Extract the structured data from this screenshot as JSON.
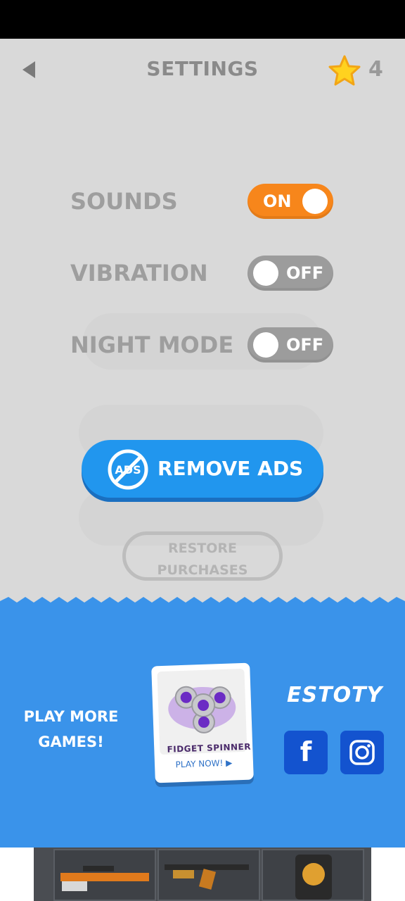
{
  "header": {
    "title": "SETTINGS",
    "back_icon": "back-arrow-icon",
    "star_icon": "star-icon",
    "star_count": "4"
  },
  "settings": {
    "sounds": {
      "label": "SOUNDS",
      "state": "ON"
    },
    "vibration": {
      "label": "VIBRATION",
      "state": "OFF"
    },
    "night_mode": {
      "label": "NIGHT MODE",
      "state": "OFF"
    }
  },
  "buttons": {
    "remove_ads_label": "REMOVE ADS",
    "remove_ads_icon_text": "ADS",
    "restore_line1": "RESTORE",
    "restore_line2": "PURCHASES"
  },
  "promo": {
    "play_more_line1": "PLAY MORE",
    "play_more_line2": "GAMES!",
    "game_title": "FIDGET SPINNER",
    "game_cta": "PLAY NOW!",
    "brand": "ESTOTY",
    "social": [
      "facebook",
      "instagram"
    ]
  },
  "colors": {
    "panel_bg": "#d9d9d9",
    "toggle_on": "#f7861b",
    "toggle_off": "#9c9c9c",
    "remove_ads": "#2196ee",
    "promo_bg": "#3a93ea",
    "social_bg": "#1353cf"
  }
}
